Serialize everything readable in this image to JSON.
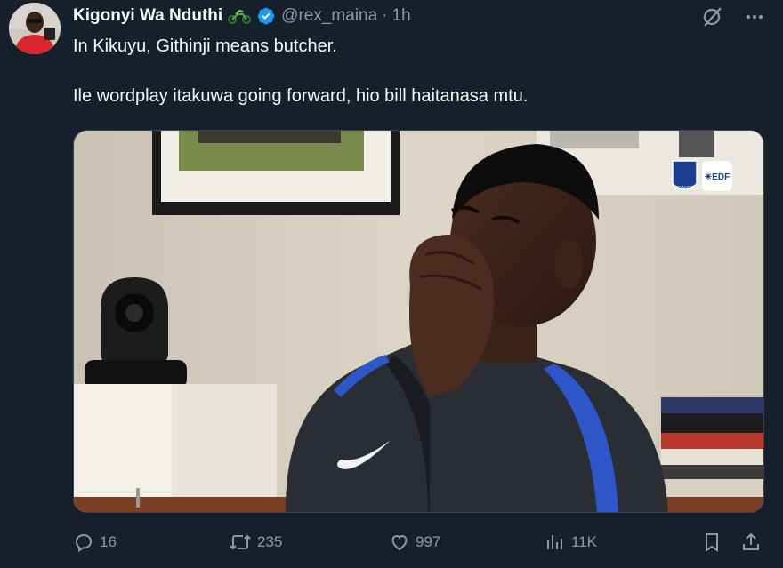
{
  "author": {
    "name": "Kigonyi Wa Nduthi",
    "handle": "@rex_maina",
    "separator": "·",
    "time": "1h",
    "verified": true
  },
  "tweet": {
    "line1": "In Kikuyu, Githinji means butcher.",
    "line2": "Ile wordplay itakuwa going forward, hio bill haitanasa mtu."
  },
  "media": {
    "kind": "photo",
    "logos": [
      "france-fff-crest-icon",
      "edf-logo"
    ]
  },
  "actions": {
    "replies": "16",
    "retweets": "235",
    "likes": "997",
    "views": "11K"
  },
  "colors": {
    "background": "#15202b",
    "text": "#f7f9f9",
    "muted": "#8b98a5",
    "verified": "#1d9bf0"
  },
  "icons": {
    "header": [
      "grok-icon",
      "more-icon"
    ],
    "badges": [
      "motorbike-icon",
      "verified-badge-icon"
    ],
    "actions": [
      "reply-icon",
      "retweet-icon",
      "like-icon",
      "views-icon",
      "bookmark-icon",
      "share-icon"
    ]
  }
}
